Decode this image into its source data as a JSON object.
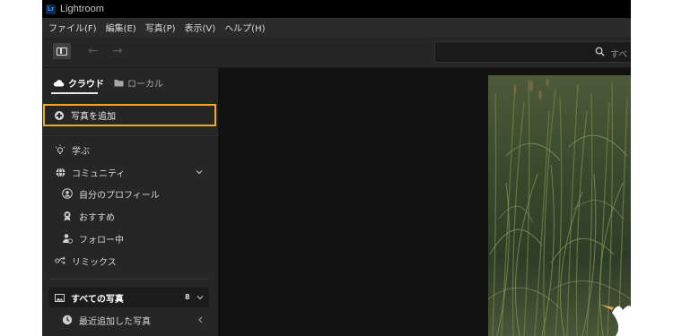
{
  "app": {
    "logo_text": "Lr",
    "title": "Lightroom"
  },
  "menu": [
    "ファイル(F)",
    "編集(E)",
    "写真(P)",
    "表示(V)",
    "ヘルプ(H)"
  ],
  "toolbar": {
    "search_placeholder": "すべ"
  },
  "sidebar": {
    "tabs": {
      "cloud": "クラウド",
      "local": "ローカル"
    },
    "add_photos": "写真を追加",
    "items": [
      {
        "label": "学ぶ",
        "icon": "lightbulb-icon"
      },
      {
        "label": "コミュニティ",
        "icon": "globe-icon"
      },
      {
        "label": "自分のプロフィール",
        "icon": "profile-icon"
      },
      {
        "label": "おすすめ",
        "icon": "award-icon"
      },
      {
        "label": "フォロー中",
        "icon": "following-icon"
      },
      {
        "label": "リミックス",
        "icon": "remix-icon"
      }
    ],
    "all_photos": {
      "label": "すべての写真",
      "count": "8"
    },
    "recent": "最近追加した写真"
  },
  "colors": {
    "highlight": "#f5a623",
    "background": "#1e1e1e",
    "sidebar": "#262626"
  }
}
